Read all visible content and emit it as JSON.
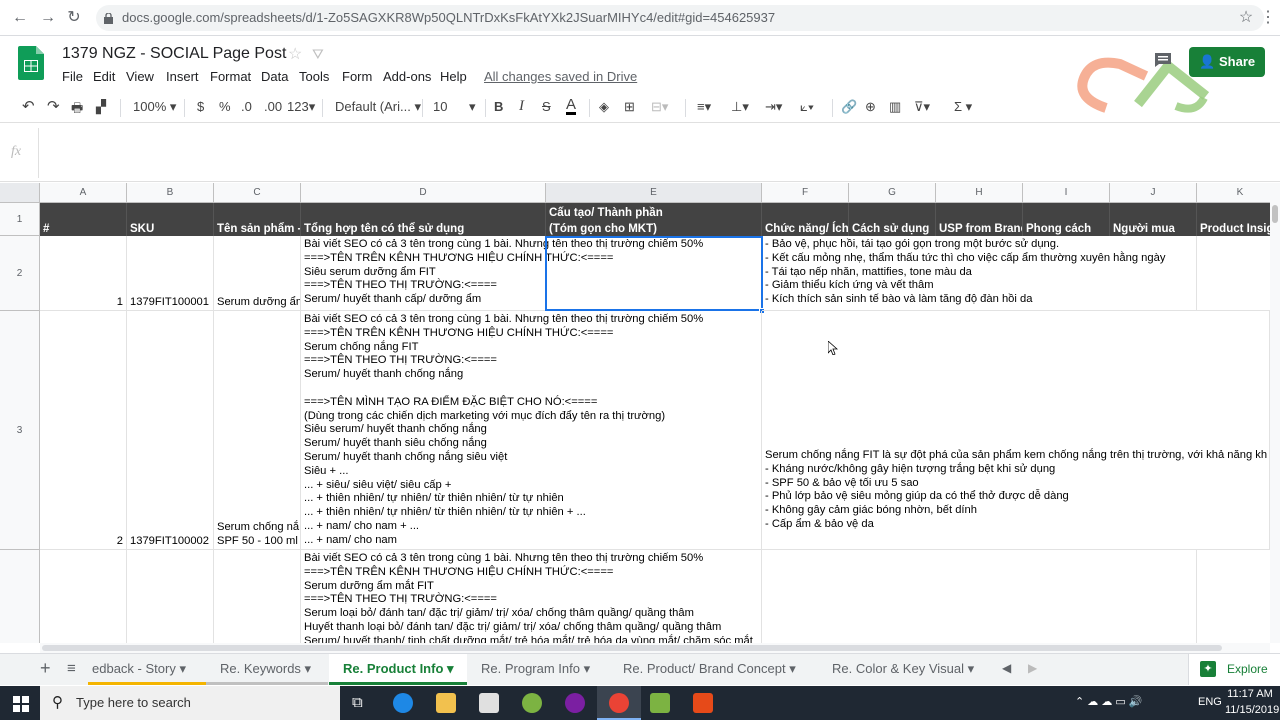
{
  "browser": {
    "url": "docs.google.com/spreadsheets/d/1-Zo5SAGXKR8Wp50QLNTrDxKsFkAtYXk2JSuarMIHYc4/edit#gid=454625937"
  },
  "doc": {
    "title": "1379 NGZ - SOCIAL Page Post",
    "menu": [
      "File",
      "Edit",
      "View",
      "Insert",
      "Format",
      "Data",
      "Tools",
      "Form",
      "Add-ons",
      "Help"
    ],
    "saved_status": "All changes saved in Drive",
    "share_label": "Share"
  },
  "toolbar": {
    "zoom": "100%",
    "currency": "$",
    "percent": "%",
    "dec_less": ".0",
    "dec_more": ".00",
    "more_formats": "123",
    "font": "Default (Ari...",
    "font_size": "10",
    "bold": "B",
    "italic": "I",
    "strike": "S",
    "text_color": "A",
    "function": "Σ"
  },
  "formula_bar": {
    "fx": "fx",
    "value": ""
  },
  "grid": {
    "columns": [
      "A",
      "B",
      "C",
      "D",
      "E",
      "F",
      "G",
      "H",
      "I",
      "J",
      "K"
    ],
    "header_row": {
      "row_num": "1",
      "A": "#",
      "B": "SKU",
      "C": "Tên sản phẩm - ",
      "D": "Tổng hợp tên có thể sử dụng",
      "E_line1": "Cấu tạo/ Thành phần",
      "E_line2": "(Tóm gọn cho MKT)",
      "F": "Chức năng/ Ích",
      "G": "Cách sử dụng",
      "H": "USP from Brand",
      "I": "Phong cách",
      "J": "Người mua",
      "K": "Product Insight"
    },
    "row2": {
      "row_num": "2",
      "A": "1",
      "B": "1379FIT100001",
      "C": "Serum dưỡng ẩm",
      "D": [
        "Bài viết SEO có cả 3 tên trong cùng 1 bài. Nhưng tên theo thị trường chiếm 50%",
        "===>TÊN TRÊN KÊNH THƯƠNG HIỆU CHÍNH THỨC:<====",
        "Siêu serum dưỡng ẩm FIT",
        "===>TÊN THEO THỊ TRƯỜNG:<====",
        "Serum/ huyết thanh cấp/ dưỡng ẩm"
      ],
      "F": [
        "- Bảo vệ, phục hồi, tái tạo gói gọn trong một bước sử dụng.",
        "- Kết cấu mỏng nhẹ, thẩm thấu tức thì cho việc cấp ẩm thường xuyên hằng ngày",
        "- Tái tạo nếp nhăn, mattifies, tone màu da",
        "- Giảm thiểu kích ứng và vết thâm",
        "- Kích thích sản sinh tế bào và làm tăng độ đàn hồi da"
      ]
    },
    "row3": {
      "row_num": "3",
      "A": "2",
      "B": "1379FIT100002",
      "C_line1": "Serum chống nắ",
      "C_line2": "SPF 50 - 100 ml",
      "D": [
        "Bài viết SEO có cả 3 tên trong cùng 1 bài. Nhưng tên theo thị trường chiếm 50%",
        "===>TÊN TRÊN KÊNH THƯƠNG HIỆU CHÍNH THỨC:<====",
        "Serum chống nắng FIT",
        "===>TÊN THEO THỊ TRƯỜNG:<====",
        "Serum/ huyết thanh chống nắng",
        "",
        "===>TÊN MÌNH TẠO RA ĐIỂM ĐẶC BIỆT CHO NÓ:<====",
        "(Dùng trong các chiến dịch marketing với mục đích đẩy tên ra thị trường)",
        "Siêu serum/ huyết thanh chống nắng",
        "Serum/ huyết thanh siêu chống nắng",
        "Serum/ huyết thanh chống nắng siêu việt",
        "Siêu + ...",
        "... + siêu/ siêu việt/ siêu cấp +",
        "... + thiên nhiên/ tự nhiên/ từ thiên nhiên/ từ tự nhiên",
        "... + thiên nhiên/ tự nhiên/ từ thiên nhiên/ từ tự nhiên + ...",
        "... + nam/ cho nam + ...",
        "... + nam/ cho nam"
      ],
      "F": [
        "Serum chống nắng FIT là sự đột phá của sản phẩm kem chống nắng trên thị trường, với khả năng kh",
        "- Kháng nước/không gây hiện tượng trắng bệt khi sử dụng",
        "- SPF 50 & bảo vệ tối ưu 5 sao",
        "- Phủ lớp bảo vệ siêu mỏng giúp da có thể thở được dễ dàng",
        "- Không gây cảm giác bóng nhờn, bết dính",
        "- Cấp ẩm & bảo vệ da"
      ]
    },
    "row4": {
      "D": [
        "Bài viết SEO có cả 3 tên trong cùng 1 bài. Nhưng tên theo thị trường chiếm 50%",
        "===>TÊN TRÊN KÊNH THƯƠNG HIỆU CHÍNH THỨC:<====",
        "Serum dưỡng ẩm mắt FIT",
        "===>TÊN THEO THỊ TRƯỜNG:<====",
        "Serum loại bỏ/ đánh tan/ đặc trị/ giảm/ trị/ xóa/ chống thâm quầng/ quầng thâm",
        "Huyết thanh loại bỏ/ đánh tan/ đặc trị/ giảm/ trị/ xóa/ chống thâm quầng/ quầng thâm",
        "Serum/ huyết thanh/ tinh chất dưỡng mắt/ trẻ hóa mắt/ trẻ hóa da vùng mắt/ chăm sóc mắt"
      ]
    }
  },
  "sheet_tabs": {
    "add": "+",
    "list": "≡",
    "items": [
      "edback - Story",
      "Re. Keywords",
      "Re. Product Info",
      "Re. Program Info",
      "Re. Product/ Brand Concept",
      "Re. Color & Key Visual"
    ],
    "active_index": 2,
    "explore": "Explore"
  },
  "taskbar": {
    "search_placeholder": "Type here to search",
    "lang": "ENG",
    "time": "11:17 AM",
    "date": "11/15/2019"
  },
  "colors": {
    "green": "#188038",
    "header_dark": "#434343",
    "selection": "#1a73e8"
  }
}
